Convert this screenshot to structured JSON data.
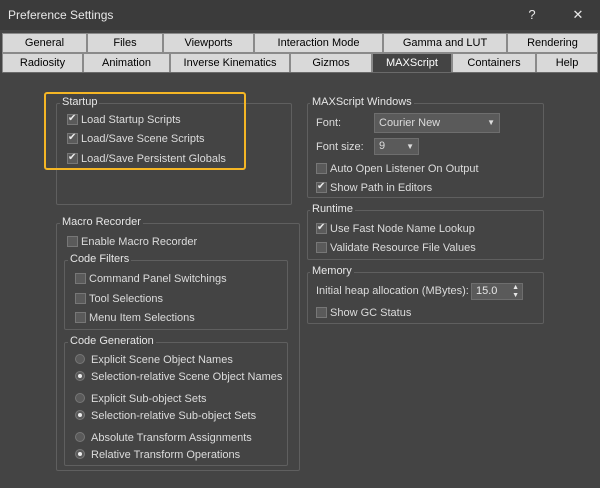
{
  "window": {
    "title": "Preference Settings",
    "help_glyph": "?",
    "close_glyph": "✕"
  },
  "tabs": {
    "row1": [
      "General",
      "Files",
      "Viewports",
      "Interaction Mode",
      "Gamma and LUT",
      "Rendering"
    ],
    "row2": [
      "Radiosity",
      "Animation",
      "Inverse Kinematics",
      "Gizmos",
      "MAXScript",
      "Containers",
      "Help"
    ],
    "active": "MAXScript"
  },
  "startup": {
    "label": "Startup",
    "items": [
      {
        "label": "Load Startup Scripts",
        "checked": true
      },
      {
        "label": "Load/Save Scene Scripts",
        "checked": true
      },
      {
        "label": "Load/Save Persistent Globals",
        "checked": true
      }
    ]
  },
  "macro_recorder": {
    "label": "Macro Recorder",
    "enable": {
      "label": "Enable Macro Recorder",
      "checked": false
    },
    "code_filters": {
      "label": "Code Filters",
      "items": [
        {
          "label": "Command Panel Switchings",
          "checked": false
        },
        {
          "label": "Tool Selections",
          "checked": false
        },
        {
          "label": "Menu Item Selections",
          "checked": false
        }
      ]
    },
    "code_generation": {
      "label": "Code Generation",
      "options": [
        {
          "label": "Explicit Scene Object Names",
          "selected": false
        },
        {
          "label": "Selection-relative Scene Object Names",
          "selected": true
        },
        {
          "label": "Explicit Sub-object Sets",
          "selected": false
        },
        {
          "label": "Selection-relative Sub-object Sets",
          "selected": true
        },
        {
          "label": "Absolute Transform Assignments",
          "selected": false
        },
        {
          "label": "Relative Transform Operations",
          "selected": true
        }
      ]
    }
  },
  "maxscript_windows": {
    "label": "MAXScript Windows",
    "font_label": "Font:",
    "font_value": "Courier New",
    "font_size_label": "Font size:",
    "font_size_value": "9",
    "auto_open": {
      "label": "Auto Open Listener On Output",
      "checked": false
    },
    "show_path": {
      "label": "Show Path in Editors",
      "checked": true
    }
  },
  "runtime": {
    "label": "Runtime",
    "fast_lookup": {
      "label": "Use Fast Node Name Lookup",
      "checked": true
    },
    "validate": {
      "label": "Validate Resource File Values",
      "checked": false
    }
  },
  "memory": {
    "label": "Memory",
    "heap_label": "Initial heap allocation (MBytes):",
    "heap_value": "15.0",
    "show_gc": {
      "label": "Show GC Status",
      "checked": false
    }
  },
  "colors": {
    "highlight": "#f5b625",
    "panel": "#444444",
    "tab_inactive": "#d9d9d9"
  }
}
